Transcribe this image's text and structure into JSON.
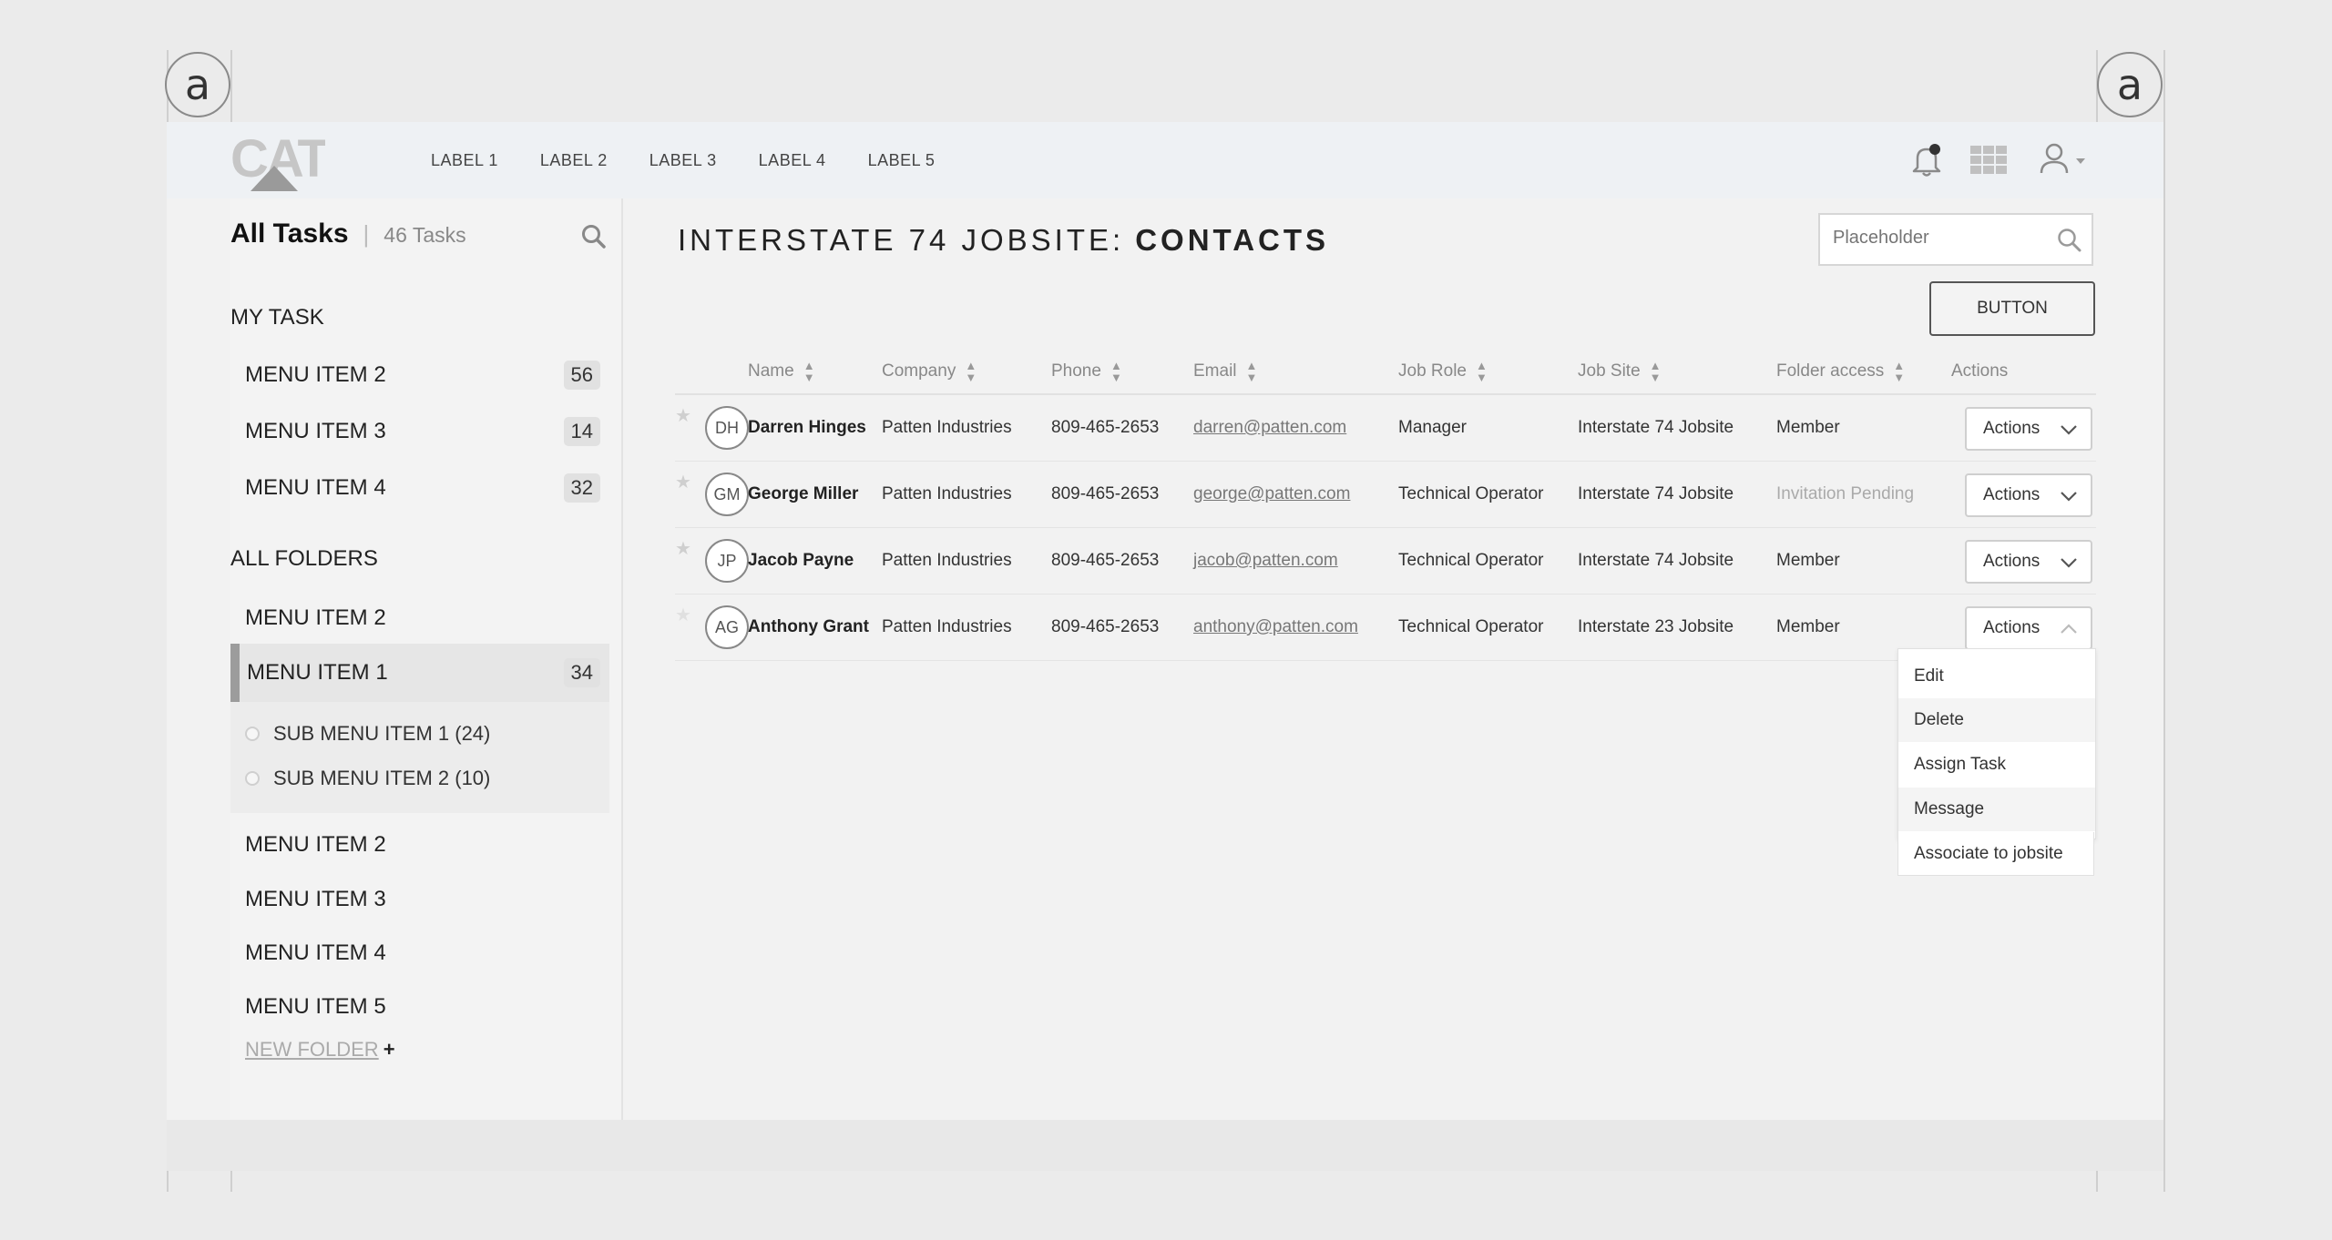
{
  "badges": {
    "left": "a",
    "right": "a"
  },
  "header": {
    "logo_text": "CAT",
    "nav": [
      "LABEL 1",
      "LABEL 2",
      "LABEL 3",
      "LABEL 4",
      "LABEL 5"
    ],
    "icons": [
      "bell-icon",
      "grid-icon",
      "user-icon",
      "chevron-down-icon"
    ]
  },
  "sidebar": {
    "title": "All Tasks",
    "separator": "|",
    "task_count": "46 Tasks",
    "my_task_heading": "MY TASK",
    "my_tasks": [
      {
        "label": "MENU ITEM 2",
        "count": "56"
      },
      {
        "label": "MENU ITEM 3",
        "count": "14"
      },
      {
        "label": "MENU ITEM 4",
        "count": "32"
      }
    ],
    "all_folders_heading": "ALL FOLDERS",
    "folders_top": {
      "label": "MENU ITEM 2"
    },
    "active_folder": {
      "label": "MENU ITEM 1",
      "count": "34"
    },
    "sub_items": [
      "SUB MENU ITEM 1 (24)",
      "SUB MENU ITEM 2 (10)"
    ],
    "folders_rest": [
      "MENU ITEM 2",
      "MENU ITEM 3",
      "MENU ITEM 4",
      "MENU ITEM 5"
    ],
    "new_folder_label": "NEW FOLDER",
    "new_folder_plus": "+"
  },
  "main": {
    "title_prefix": "INTERSTATE 74 JOBSITE:",
    "title_strong": "CONTACTS",
    "search_placeholder": "Placeholder",
    "button_label": "BUTTON",
    "columns": [
      "Name",
      "Company",
      "Phone",
      "Email",
      "Job Role",
      "Job Site",
      "Folder access",
      "Actions"
    ],
    "rows": [
      {
        "initials": "DH",
        "name": "Darren Hinges",
        "company": "Patten Industries",
        "phone": "809-465-2653",
        "email": "darren@patten.com",
        "role": "Manager",
        "site": "Interstate 74 Jobsite",
        "access": "Member",
        "action": "Actions"
      },
      {
        "initials": "GM",
        "name": "George Miller",
        "company": "Patten Industries",
        "phone": "809-465-2653",
        "email": "george@patten.com",
        "role": "Technical Operator",
        "site": "Interstate 74 Jobsite",
        "access": "Invitation Pending",
        "action": "Actions"
      },
      {
        "initials": "JP",
        "name": "Jacob Payne",
        "company": "Patten Industries",
        "phone": "809-465-2653",
        "email": "jacob@patten.com",
        "role": "Technical Operator",
        "site": "Interstate 74 Jobsite",
        "access": "Member",
        "action": "Actions"
      },
      {
        "initials": "AG",
        "name": "Anthony Grant",
        "company": "Patten Industries",
        "phone": "809-465-2653",
        "email": "anthony@patten.com",
        "role": "Technical Operator",
        "site": "Interstate 23 Jobsite",
        "access": "Member",
        "action": "Actions"
      }
    ],
    "dropdown": [
      "Edit",
      "Delete",
      "Assign Task",
      "Message",
      "Associate to jobsite"
    ]
  },
  "colors": {
    "background": "#ebebeb",
    "header_bg": "#eef1f4",
    "sidebar_bg": "#f3f3f3",
    "active_bar": "#9c9c9c",
    "pending_text": "#aaaaaa"
  }
}
